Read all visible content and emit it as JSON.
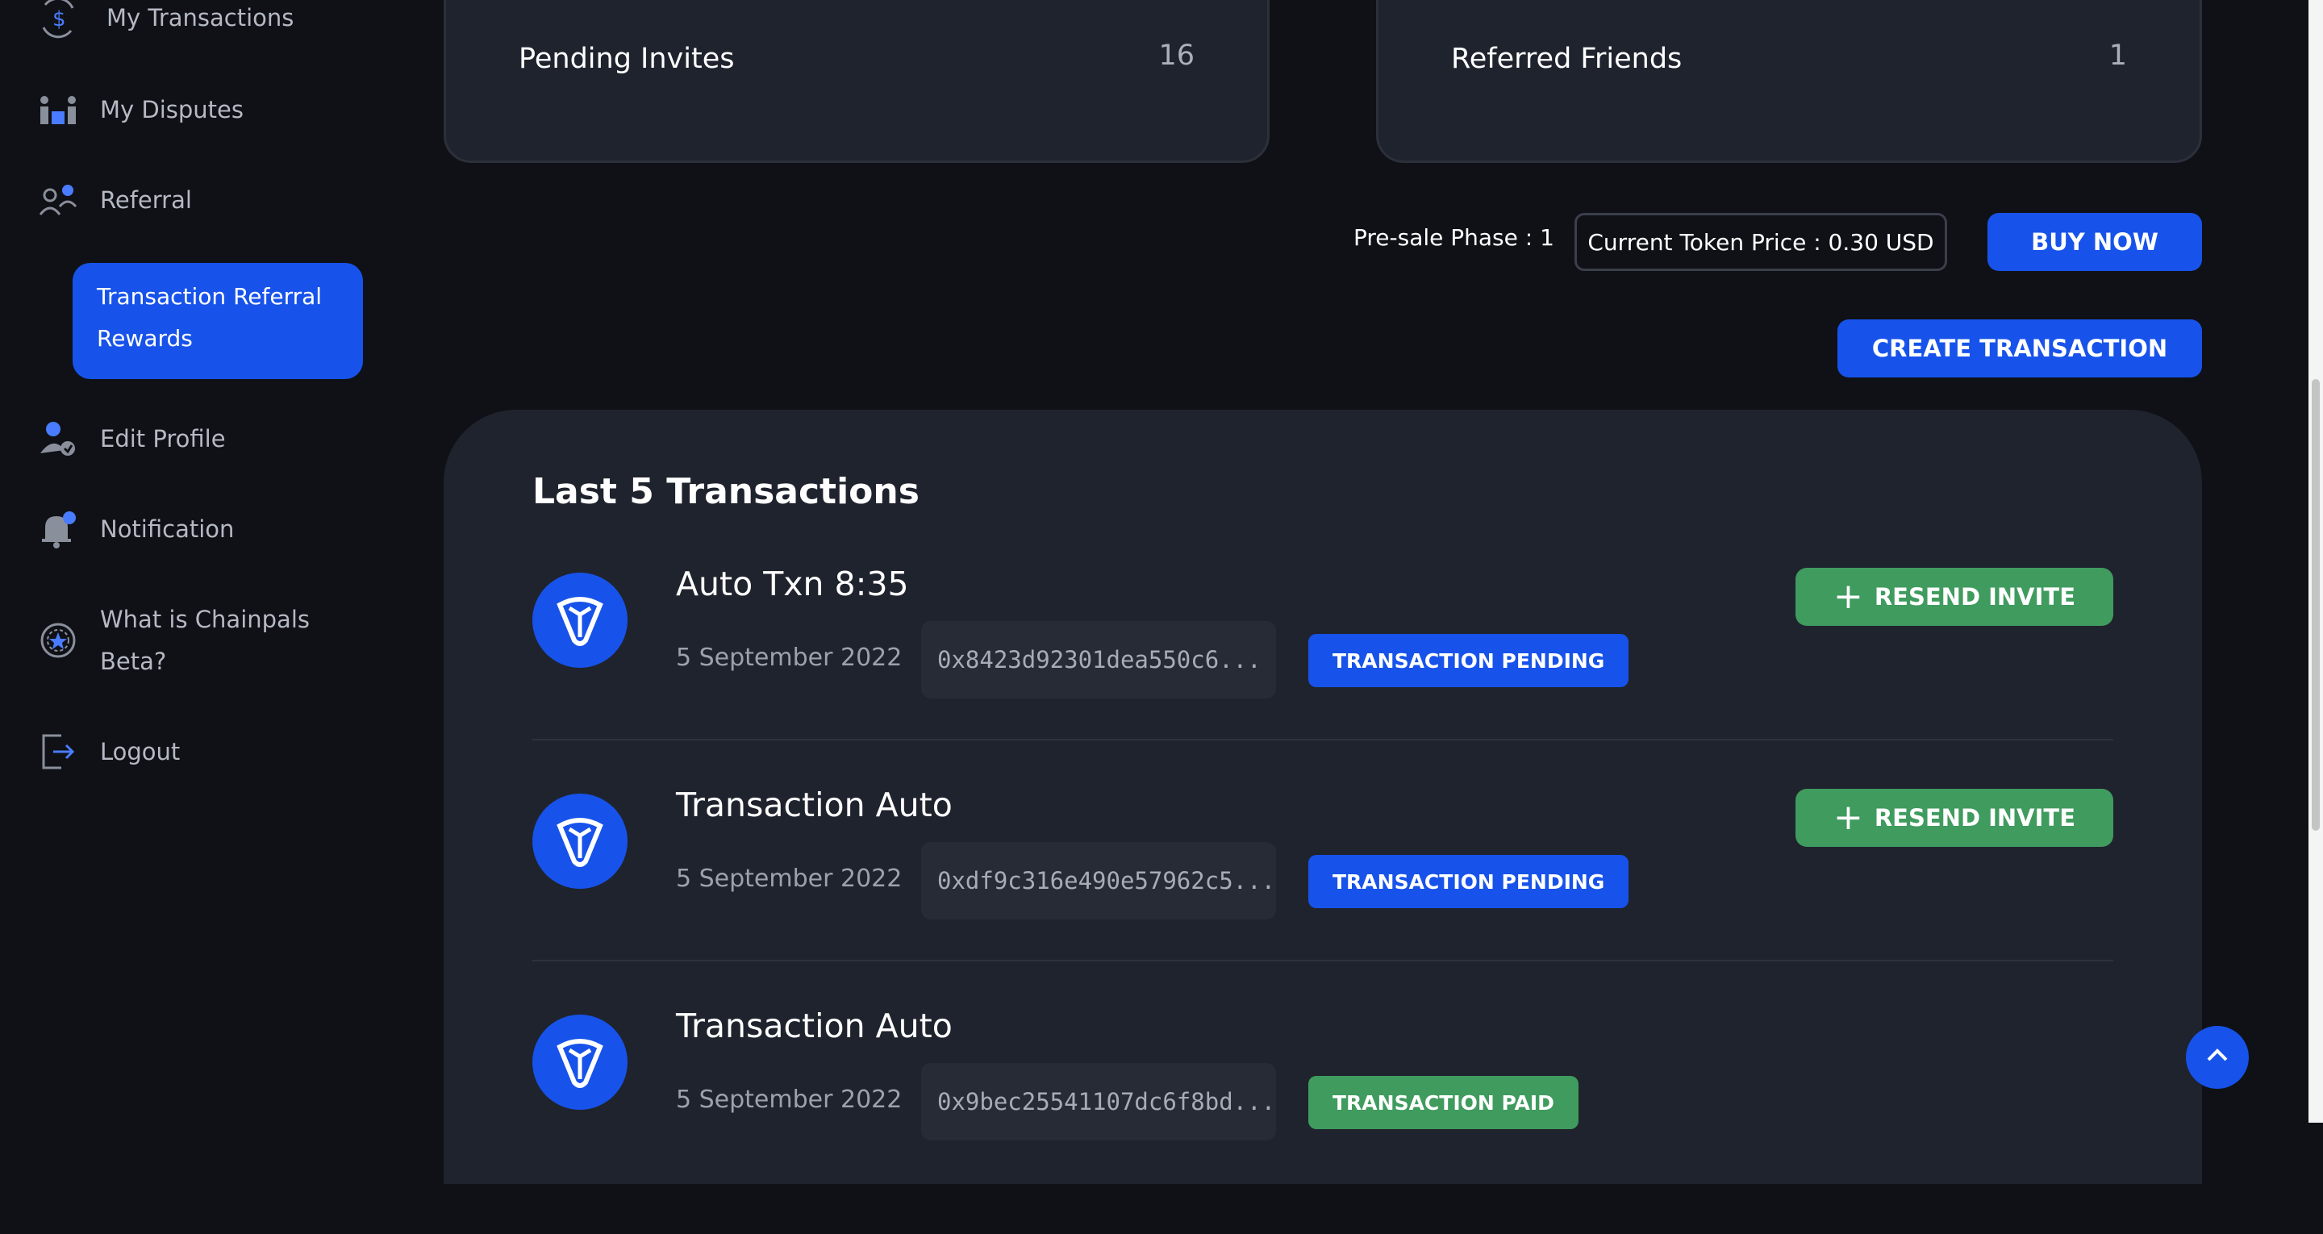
{
  "sidebar": {
    "items": [
      {
        "label": "My Transactions",
        "icon": "dollar-exchange-icon"
      },
      {
        "label": "My Disputes",
        "icon": "disputes-icon"
      },
      {
        "label": "Referral",
        "icon": "referral-icon"
      },
      {
        "label": "Transaction Referral Rewards",
        "icon": ""
      },
      {
        "label": "Edit Profile",
        "icon": "edit-profile-icon"
      },
      {
        "label": "Notification",
        "icon": "bell-icon"
      },
      {
        "label": "What is Chainpals Beta?",
        "icon": "chainpals-icon"
      },
      {
        "label": "Logout",
        "icon": "logout-icon"
      }
    ]
  },
  "stats": {
    "pending_invites": {
      "label": "Pending Invites",
      "value": "16"
    },
    "referred_friends": {
      "label": "Referred Friends",
      "value": "1"
    }
  },
  "token": {
    "phase": "Pre-sale Phase : 1",
    "price": "Current Token Price : 0.30 USD",
    "buy_label": "BUY NOW"
  },
  "create_label": "CREATE TRANSACTION",
  "transactions": {
    "title": "Last 5 Transactions",
    "resend_label": "RESEND INVITE",
    "items": [
      {
        "name": "Auto Txn 8:35",
        "date": "5 September 2022",
        "hash": "0x8423d92301dea550c6...",
        "status": "TRANSACTION PENDING",
        "status_color": "#1753ea"
      },
      {
        "name": "Transaction Auto",
        "date": "5 September 2022",
        "hash": "0xdf9c316e490e57962c5...",
        "status": "TRANSACTION PENDING",
        "status_color": "#1753ea"
      },
      {
        "name": "Transaction Auto",
        "date": "5 September 2022",
        "hash": "0x9bec25541107dc6f8bd...",
        "status": "TRANSACTION PAID",
        "status_color": "#3f9b5e"
      }
    ]
  },
  "colors": {
    "accent": "#1753ea",
    "success": "#3f9b5e",
    "panel": "#1f232d",
    "background": "#0f1116"
  }
}
